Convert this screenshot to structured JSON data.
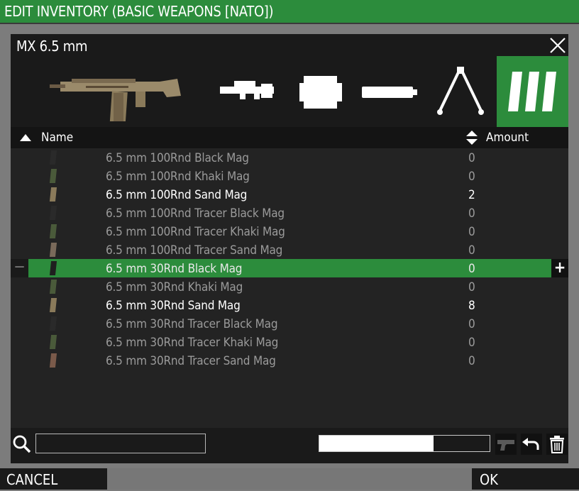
{
  "window": {
    "title": "EDIT INVENTORY (BASIC WEAPONS [NATO])"
  },
  "weapon": {
    "name": "MX 6.5 mm"
  },
  "slots": {
    "weapon": "rifle-icon",
    "optic": "scope-icon",
    "muzzle": "muzzle-icon",
    "rail": "silencer-icon",
    "bipod": "bipod-icon",
    "magazines": "magazines-icon",
    "active": "magazines"
  },
  "columns": {
    "name": "Name",
    "amount": "Amount"
  },
  "items": [
    {
      "name": "6.5 mm 100Rnd Black Mag",
      "amount": "0",
      "color": "#2a2a2a"
    },
    {
      "name": "6.5 mm 100Rnd Khaki Mag",
      "amount": "0",
      "color": "#4a5a3a"
    },
    {
      "name": "6.5 mm 100Rnd Sand Mag",
      "amount": "2",
      "color": "#8a7a5a"
    },
    {
      "name": "6.5 mm 100Rnd Tracer Black Mag",
      "amount": "0",
      "color": "#2a2a2a"
    },
    {
      "name": "6.5 mm 100Rnd Tracer Khaki Mag",
      "amount": "0",
      "color": "#4a5a3a"
    },
    {
      "name": "6.5 mm 100Rnd Tracer Sand Mag",
      "amount": "0",
      "color": "#7a6a5a"
    },
    {
      "name": "6.5 mm 30Rnd Black Mag",
      "amount": "0",
      "color": "#1f1f1f"
    },
    {
      "name": "6.5 mm 30Rnd Khaki Mag",
      "amount": "0",
      "color": "#4a5a3a"
    },
    {
      "name": "6.5 mm 30Rnd Sand Mag",
      "amount": "8",
      "color": "#8a7a5a"
    },
    {
      "name": "6.5 mm 30Rnd Tracer Black Mag",
      "amount": "0",
      "color": "#2a2a2a"
    },
    {
      "name": "6.5 mm 30Rnd Tracer Khaki Mag",
      "amount": "0",
      "color": "#4a5a3a"
    },
    {
      "name": "6.5 mm 30Rnd Tracer Sand Mag",
      "amount": "0",
      "color": "#7a5a4a"
    }
  ],
  "selected_index": 6,
  "controls": {
    "minus": "−",
    "plus": "+"
  },
  "search": {
    "value": "",
    "placeholder": ""
  },
  "load": {
    "fraction": 0.67
  },
  "toolbar": {
    "pistol_icon": "pistol-icon",
    "undo_icon": "undo-icon",
    "trash_icon": "trash-icon"
  },
  "footer": {
    "cancel": "CANCEL",
    "ok": "OK"
  },
  "colors": {
    "accent": "#2c8c3c",
    "panel": "#232323",
    "header": "#1a1a1a"
  }
}
